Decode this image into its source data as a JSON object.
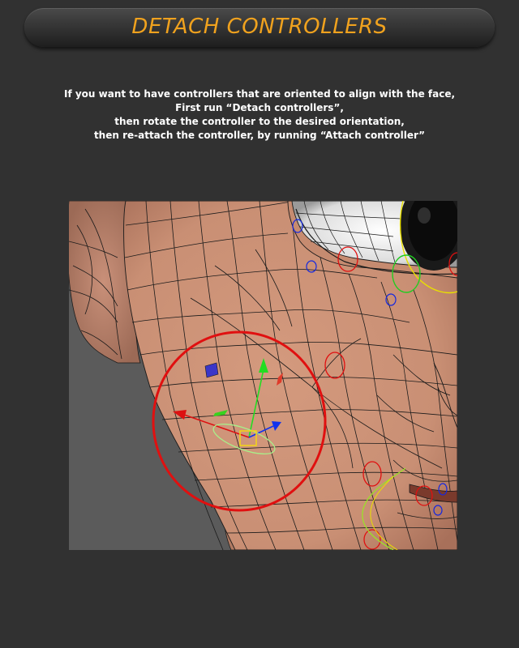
{
  "header": {
    "title": "DETACH CONTROLLERS"
  },
  "instructions": {
    "lines": [
      "If you want to have controllers that are oriented to align with the face,",
      "First run “Detach controllers”,",
      "then rotate the controller to the desired orientation,",
      "then re-attach the controller, by running “Attach controller”"
    ]
  },
  "colors": {
    "title": "#f0a21e",
    "background": "#313131",
    "viewport_background": "#5b5b5b",
    "skin": "#c98f74",
    "controller_circle": "#e01010",
    "gizmo_y_axis": "#22dd22",
    "gizmo_x_axis": "#dd1111",
    "gizmo_z_axis": "#1133ee",
    "pivot_box": "#f2d21a"
  }
}
